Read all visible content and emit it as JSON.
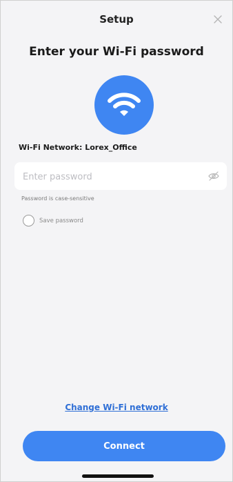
{
  "header": {
    "title": "Setup",
    "close_icon": "close-icon"
  },
  "main": {
    "heading": "Enter your Wi-Fi password",
    "wifi_icon": "wifi-icon",
    "network_label": "Wi-Fi Network:",
    "network_name": "Lorex_Office",
    "password": {
      "value": "",
      "placeholder": "Enter password",
      "visibility_icon": "eye-off-icon"
    },
    "hint": "Password is case-sensitive",
    "save_password": {
      "label": "Save password",
      "checked": false
    }
  },
  "footer": {
    "change_network_label": "Change Wi-Fi network",
    "connect_label": "Connect"
  },
  "colors": {
    "accent": "#3f86f2",
    "link": "#2f6fd6",
    "background": "#f4f4f6"
  }
}
